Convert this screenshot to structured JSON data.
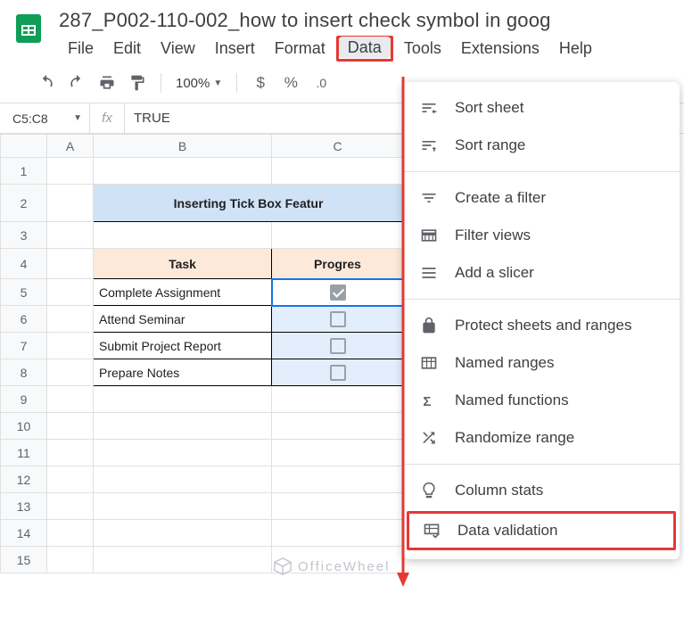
{
  "doc_title": "287_P002-110-002_how to insert check symbol in goog",
  "menu": [
    "File",
    "Edit",
    "View",
    "Insert",
    "Format",
    "Data",
    "Tools",
    "Extensions",
    "Help"
  ],
  "menu_active_index": 5,
  "toolbar": {
    "zoom": "100%",
    "currency": "$",
    "percent": "%",
    "decimal": ".0"
  },
  "namebox": "C5:C8",
  "formula": "TRUE",
  "columns": [
    "A",
    "B",
    "C"
  ],
  "row_count": 15,
  "sheet": {
    "title": "Inserting Tick Box Featur",
    "headers": [
      "Task",
      "Progres"
    ],
    "rows": [
      {
        "task": "Complete Assignment",
        "checked": true
      },
      {
        "task": "Attend Seminar",
        "checked": false
      },
      {
        "task": "Submit Project Report",
        "checked": false
      },
      {
        "task": "Prepare Notes",
        "checked": false
      }
    ]
  },
  "dropdown": {
    "groups": [
      [
        {
          "icon": "sort-sheet",
          "label": "Sort sheet"
        },
        {
          "icon": "sort-range",
          "label": "Sort range"
        }
      ],
      [
        {
          "icon": "filter",
          "label": "Create a filter"
        },
        {
          "icon": "filter-views",
          "label": "Filter views"
        },
        {
          "icon": "slicer",
          "label": "Add a slicer"
        }
      ],
      [
        {
          "icon": "lock",
          "label": "Protect sheets and ranges"
        },
        {
          "icon": "named-ranges",
          "label": "Named ranges"
        },
        {
          "icon": "sigma",
          "label": "Named functions"
        },
        {
          "icon": "shuffle",
          "label": "Randomize range"
        }
      ],
      [
        {
          "icon": "bulb",
          "label": "Column stats"
        },
        {
          "icon": "validation",
          "label": "Data validation",
          "highlight": true
        }
      ]
    ]
  },
  "watermark": "OfficeWheel"
}
